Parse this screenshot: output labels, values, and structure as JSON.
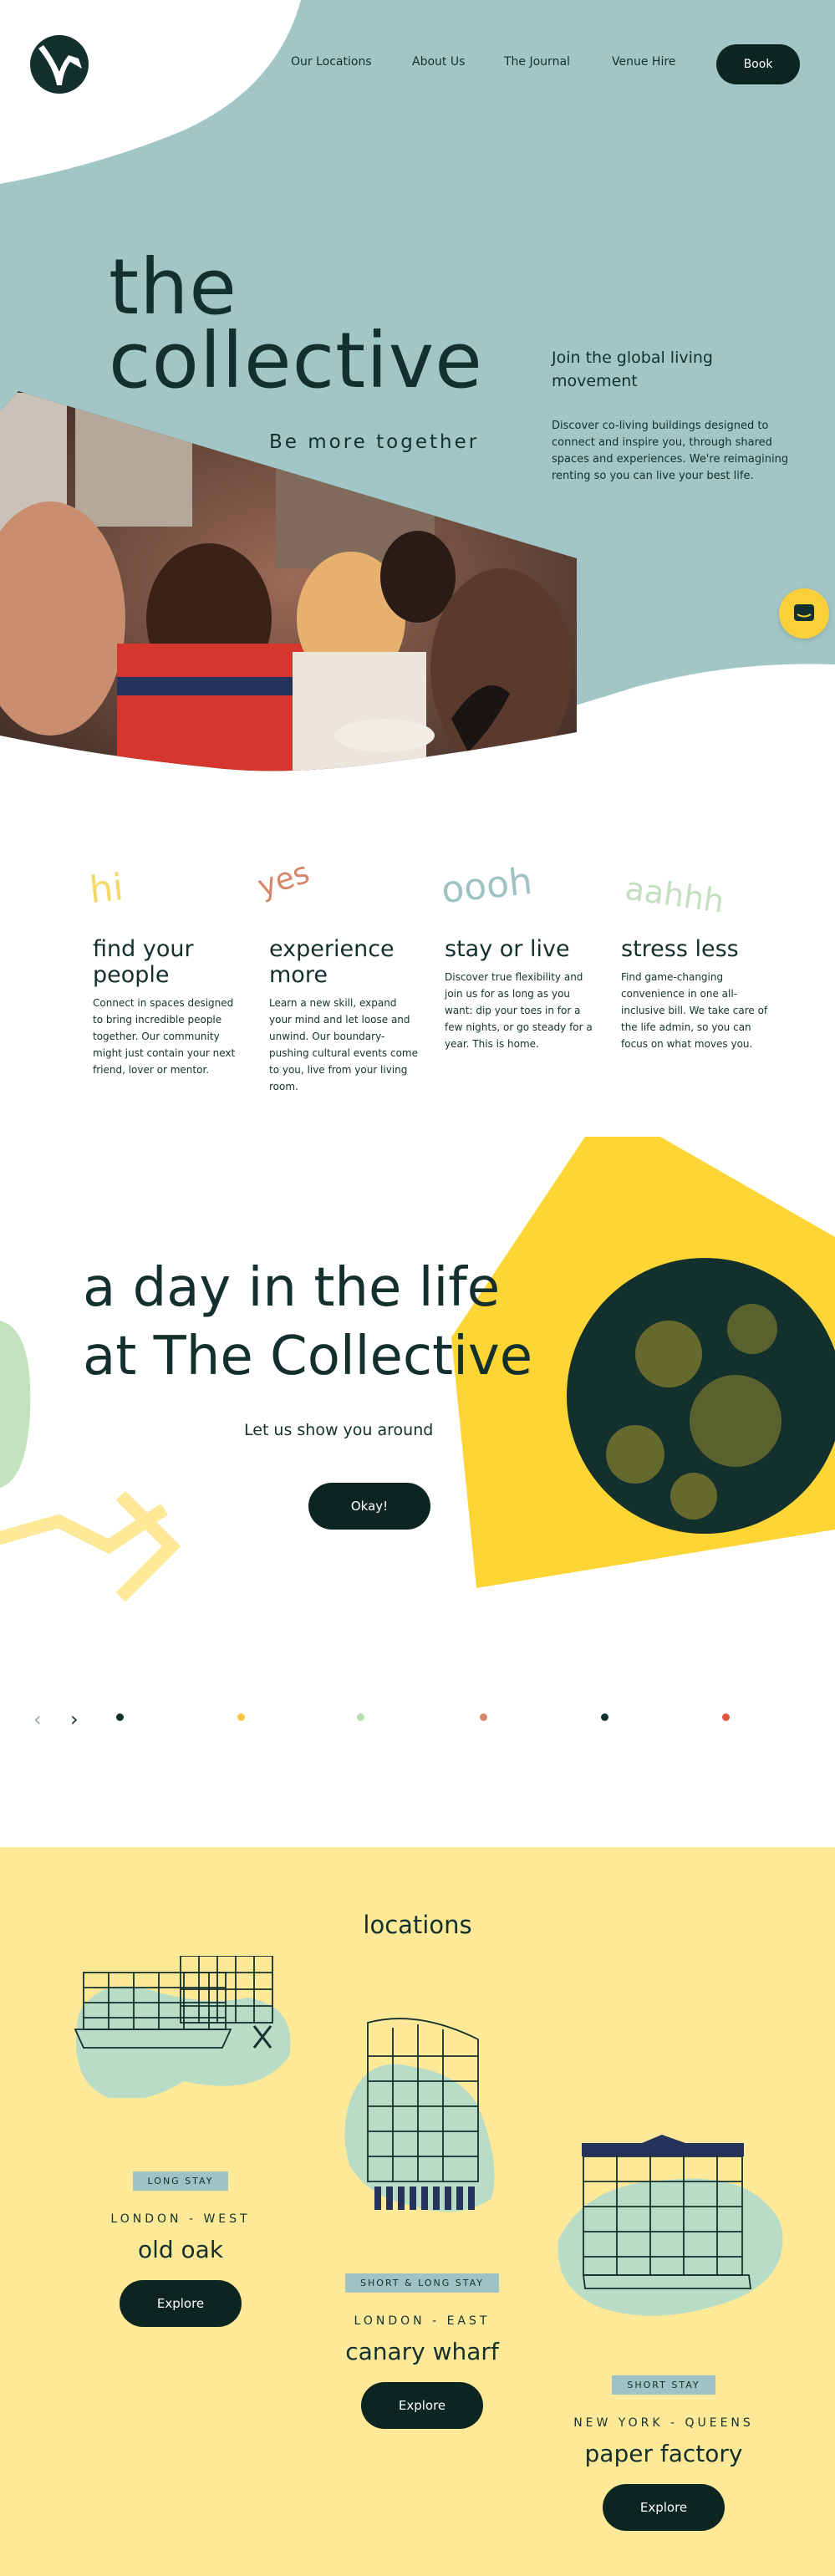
{
  "nav": {
    "links": [
      "Our Locations",
      "About Us",
      "The Journal",
      "Venue Hire"
    ],
    "book": "Book"
  },
  "hero": {
    "title_line1": "the",
    "title_line2": "collective",
    "tagline": "Be more together",
    "join_title": "Join the global living movement",
    "join_text": "Discover co-living buildings designed to connect and inspire you, through shared spaces and experiences. We're reimagining renting so you can live your best life."
  },
  "features": [
    {
      "word": "hi",
      "word_color": "#f5d86a",
      "title": "find your people",
      "text": "Connect in spaces designed to bring incredible people together. Our community might just contain your next friend, lover or mentor."
    },
    {
      "word": "yes",
      "word_color": "#d4876b",
      "title": "experience more",
      "text": "Learn a new skill, expand your mind and let loose and unwind. Our boundary-pushing cultural events come to you, live from your living room."
    },
    {
      "word": "oooh",
      "word_color": "#9fc2c4",
      "title": "stay or live",
      "text": "Discover true flexibility and join us for as long as you want: dip your toes in for a few nights, or go steady for a year. This is home."
    },
    {
      "word": "aahhh",
      "word_color": "#c3dfc0",
      "title": "stress less",
      "text": "Find game-changing convenience in one all-inclusive bill. We take care of the life admin, so you can focus on what moves you."
    }
  ],
  "life": {
    "title_line1": "a day in the life",
    "title_line2": "at The Collective",
    "subtitle": "Let us show you around",
    "button": "Okay!"
  },
  "carousel": {
    "prev": "‹",
    "next": "›",
    "dots": [
      "#14302c",
      "#f5c842",
      "#b9dcb4",
      "#d4876b",
      "#14302c",
      "#e0533f"
    ]
  },
  "locations": {
    "title": "locations",
    "items": [
      {
        "badge": "LONG STAY",
        "area": "LONDON - WEST",
        "name": "old oak",
        "button": "Explore"
      },
      {
        "badge": "SHORT & LONG STAY",
        "area": "LONDON - EAST",
        "name": "canary wharf",
        "button": "Explore"
      },
      {
        "badge": "SHORT STAY",
        "area": "NEW YORK - QUEENS",
        "name": "paper factory",
        "button": "Explore"
      }
    ]
  },
  "colors": {
    "teal": "#a2c6c6",
    "dark": "#0d2521",
    "yellow": "#fdd535",
    "cream": "#fde998",
    "mint": "#b9dcc7"
  }
}
